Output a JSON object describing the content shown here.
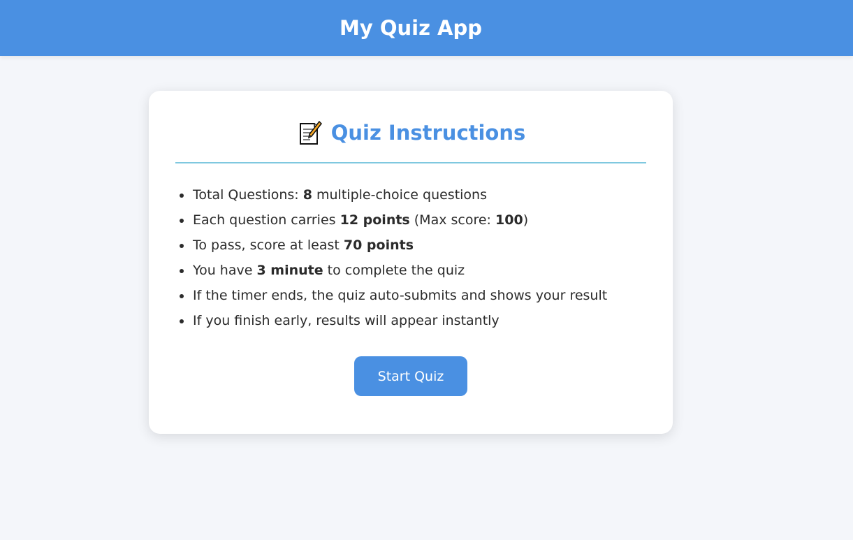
{
  "header": {
    "title": "My Quiz App"
  },
  "instructions": {
    "title": "Quiz Instructions",
    "icon": "memo-icon",
    "rules": [
      {
        "pre": "Total Questions: ",
        "b1": "8",
        "mid": " multiple-choice questions",
        "b2": "",
        "post": ""
      },
      {
        "pre": "Each question carries ",
        "b1": "12 points",
        "mid": " (Max score: ",
        "b2": "100",
        "post": ")"
      },
      {
        "pre": "To pass, score at least ",
        "b1": "70 points",
        "mid": "",
        "b2": "",
        "post": ""
      },
      {
        "pre": "You have ",
        "b1": "3 minute",
        "mid": " to complete the quiz",
        "b2": "",
        "post": ""
      },
      {
        "pre": "If the timer ends, the quiz auto-submits and shows your result",
        "b1": "",
        "mid": "",
        "b2": "",
        "post": ""
      },
      {
        "pre": "If you finish early, results will appear instantly",
        "b1": "",
        "mid": "",
        "b2": "",
        "post": ""
      }
    ],
    "start_label": "Start Quiz"
  },
  "colors": {
    "header_bg": "#4a90e2",
    "accent": "#4a90e2",
    "divider": "#7fc8df",
    "page_bg": "#f4f6fa"
  }
}
